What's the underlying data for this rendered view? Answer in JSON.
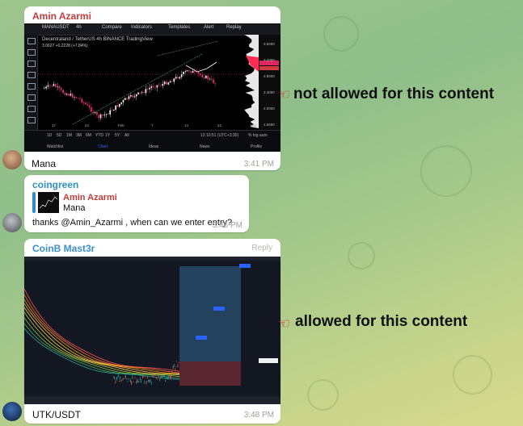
{
  "messages": [
    {
      "sender": "Amin Azarmi",
      "sender_color": "#c43b3b",
      "caption": "Mana",
      "time": "3:41 PM",
      "chart": {
        "symbol": "MANAUSDT",
        "interval": "4h",
        "toolbar": [
          "Compare",
          "Indicators",
          "Templates",
          "Alert",
          "Replay"
        ],
        "title": "Decentraland / TetherUS  4h  BINANCE  TradingView",
        "price_line": "3.0627  +0.2228 (+7.84%)",
        "x_ticks": [
          "17",
          "24",
          "Feb",
          "7",
          "14",
          "21",
          "Mar"
        ],
        "timeframes": [
          "1D",
          "5D",
          "1M",
          "3M",
          "6M",
          "YTD",
          "1Y",
          "5Y",
          "All"
        ],
        "clock": "12:10:51 (UTC+3:30)",
        "axis_mode": "%  log  auto",
        "bottom_tabs": [
          "Watchlist",
          "Chart",
          "Ideas",
          "News",
          "Profile"
        ],
        "active_tab": "Chart",
        "y_ticks": [
          "3.6000",
          "3.2000",
          "2.8000",
          "2.4000",
          "2.0000",
          "1.6000"
        ]
      }
    },
    {
      "sender": "coingreen",
      "sender_color": "#2f8fc6",
      "quote_sender": "Amin Azarmi",
      "quote_text": "Mana",
      "text": "thanks @Amin_Azarmi , when can we enter entry?",
      "time": "3:46 PM"
    },
    {
      "sender": "CoinB Mast3r",
      "sender_color": "#3a8fd0",
      "reply": "Reply",
      "caption": "UTK/USDT",
      "time": "3:48 PM"
    }
  ],
  "annotations": {
    "top": "not allowed for this content",
    "bottom": "allowed for this content"
  }
}
